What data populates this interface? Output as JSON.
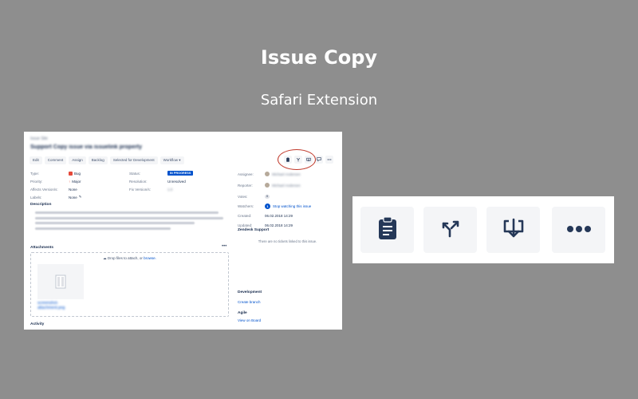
{
  "hero": {
    "title": "Issue Copy",
    "subtitle": "Safari Extension"
  },
  "issue": {
    "breadcrumb": "Issue Site",
    "title": "Support Copy issue via issuelink property",
    "toolbar": [
      "Edit",
      "Comment",
      "Assign",
      "Backlog",
      "Selected for Development",
      "Workflow ▾"
    ],
    "fields_left": [
      {
        "label": "Type:",
        "value": "Bug"
      },
      {
        "label": "Priority:",
        "value": "Major"
      },
      {
        "label": "Affects Version/s:",
        "value": "None"
      },
      {
        "label": "Labels:",
        "value": "None"
      }
    ],
    "fields_mid": [
      {
        "label": "Status:",
        "value": "IN PROGRESS"
      },
      {
        "label": "Resolution:",
        "value": "Unresolved"
      },
      {
        "label": "Fix Version/s:",
        "value": "1.0"
      }
    ],
    "description_title": "Description",
    "attachments_title": "Attachments",
    "drop_text": "Drop files to attach, or",
    "drop_link": "browse.",
    "thumb_caption": "screenshot-attachment.png",
    "activity_title": "Activity",
    "people": [
      {
        "label": "Assignee:",
        "value": "Michael Andersen"
      },
      {
        "label": "Reporter:",
        "value": "Michael Andersen"
      }
    ],
    "votes_label": "Votes:",
    "votes_value": "0",
    "watchers_label": "Watchers:",
    "watchers_count": "1",
    "watchers_link": "Stop watching this issue",
    "created_label": "Created:",
    "created_value": "06.02.2018 14:29",
    "updated_label": "Updated:",
    "updated_value": "06.02.2018 14:29",
    "zendesk_title": "Zendesk Support",
    "zendesk_empty": "There are no tickets linked to this issue.",
    "development_title": "Development",
    "create_branch": "Create branch",
    "agile_title": "Agile",
    "view_on_board": "View on Board"
  },
  "zoomed_icons": [
    "clipboard-icon",
    "branch-arrow-icon",
    "download-tray-icon",
    "more-dots-icon"
  ],
  "colors": {
    "background": "#8e8e8e",
    "accent": "#0052cc",
    "icon_dark": "#253858",
    "highlight": "#c0392b"
  }
}
